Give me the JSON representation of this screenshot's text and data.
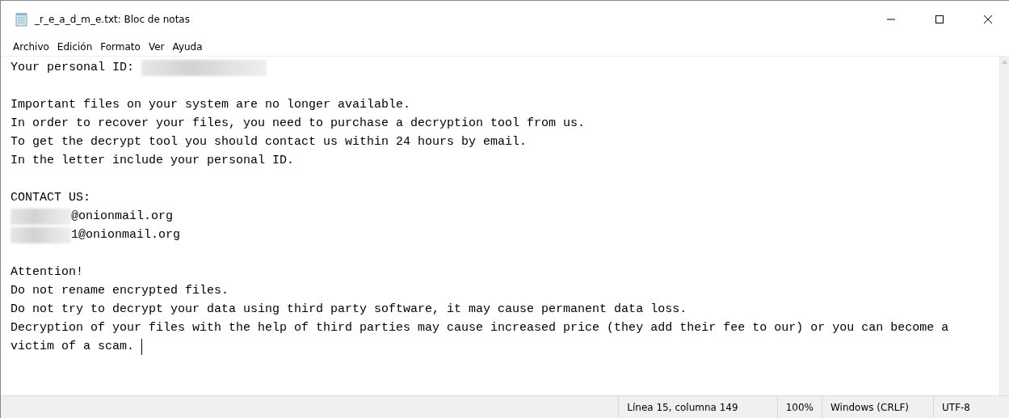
{
  "window": {
    "title": "_r_e_a_d_m_e.txt: Bloc de notas"
  },
  "menu": [
    "Archivo",
    "Edición",
    "Formato",
    "Ver",
    "Ayuda"
  ],
  "document": {
    "lines": [
      {
        "kind": "redacted_after",
        "text": "Your personal ID: "
      },
      {
        "kind": "blank"
      },
      {
        "kind": "plain",
        "text": "Important files on your system are no longer available."
      },
      {
        "kind": "plain",
        "text": "In order to recover your files, you need to purchase a decryption tool from us."
      },
      {
        "kind": "plain",
        "text": "To get the decrypt tool you should contact us within 24 hours by email."
      },
      {
        "kind": "plain",
        "text": "In the letter include your personal ID."
      },
      {
        "kind": "blank"
      },
      {
        "kind": "plain",
        "text": "CONTACT US:"
      },
      {
        "kind": "redacted_before",
        "text": "@onionmail.org"
      },
      {
        "kind": "redacted_before",
        "text": "1@onionmail.org"
      },
      {
        "kind": "blank"
      },
      {
        "kind": "plain",
        "text": "Attention!"
      },
      {
        "kind": "plain",
        "text": "Do not rename encrypted files."
      },
      {
        "kind": "plain",
        "text": "Do not try to decrypt your data using third party software, it may cause permanent data loss."
      },
      {
        "kind": "plain",
        "text": "Decryption of your files with the help of third parties may cause increased price (they add their fee to our) or you can become a"
      },
      {
        "kind": "plain",
        "text": "victim of a scam. ",
        "caret": true
      }
    ]
  },
  "status_bar": [
    "Línea 15, columna 149",
    "100%",
    "Windows (CRLF)",
    "UTF-8"
  ]
}
